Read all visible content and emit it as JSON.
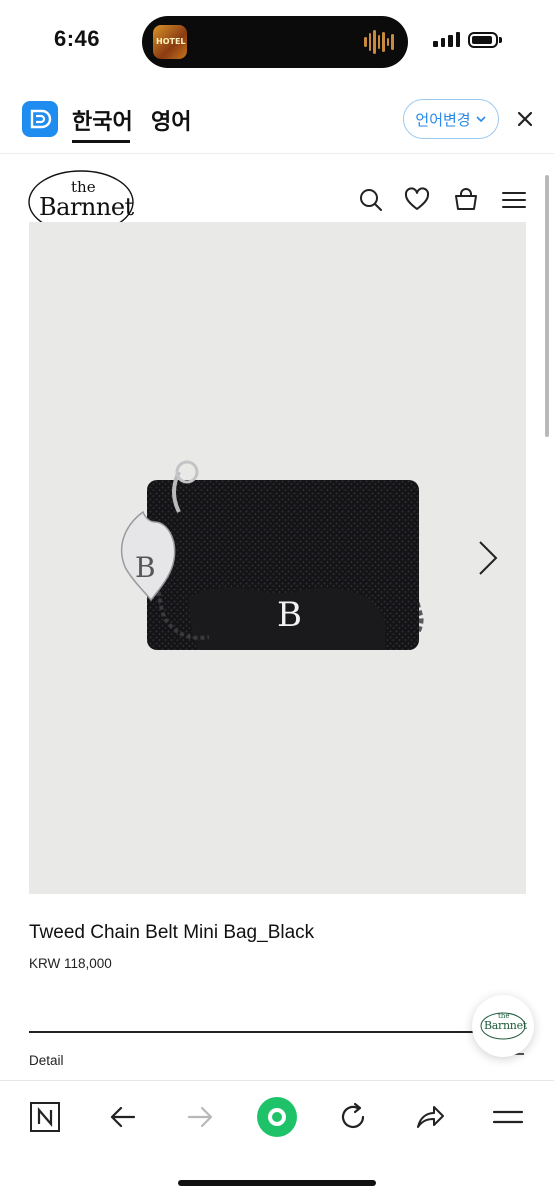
{
  "status_bar": {
    "time": "6:46",
    "island_thumbnail_text": "HOTEL"
  },
  "translate_bar": {
    "tabs": [
      "한국어",
      "영어"
    ],
    "active_tab": "한국어",
    "change_language_label": "언어변경",
    "accent_color": "#2a8ae6"
  },
  "site": {
    "logo_text_top": "the",
    "logo_text_main": "Barnnet",
    "header_icons": [
      "search-icon",
      "heart-icon",
      "shopping-bag-icon",
      "menu-icon"
    ]
  },
  "product": {
    "name": "Tweed Chain Belt Mini Bag_Black",
    "price": "KRW 118,000",
    "charm_letter": "B",
    "detail_label": "Detail"
  },
  "floating_button": {
    "logo_text_top": "the",
    "logo_text_main": "Barnnet"
  },
  "browser_toolbar": {
    "icons": [
      "naver-n-icon",
      "back-arrow-icon",
      "forward-arrow-icon",
      "green-home-icon",
      "reload-icon",
      "share-icon",
      "menu-icon"
    ],
    "green_color": "#1ec268"
  }
}
